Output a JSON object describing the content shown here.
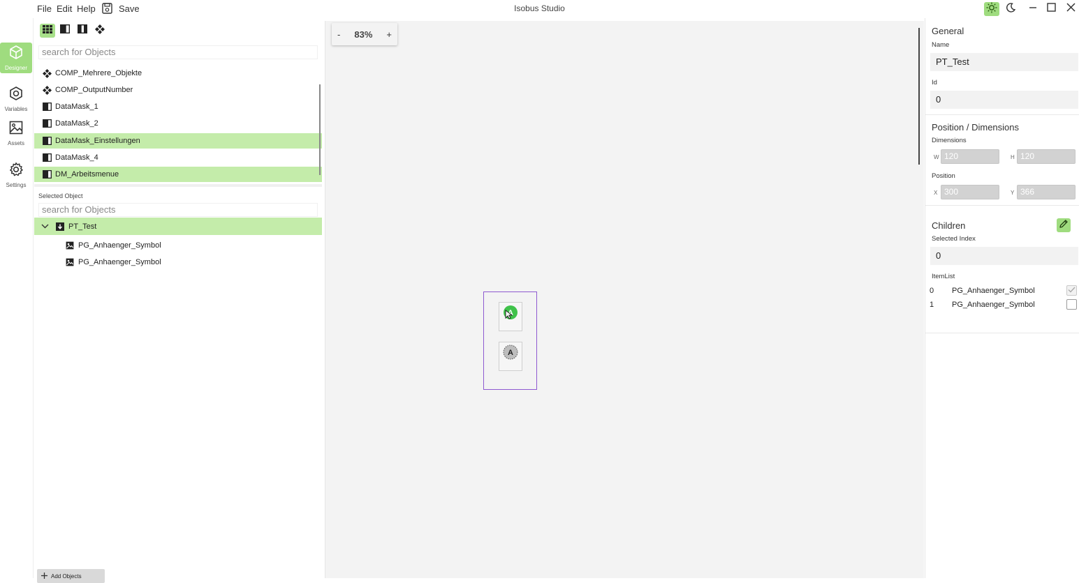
{
  "app": {
    "title": "Isobus Studio"
  },
  "menu": {
    "file": "File",
    "edit": "Edit",
    "help": "Help",
    "save": "Save"
  },
  "activity": {
    "designer": "Designer",
    "variables": "Variables",
    "assets": "Assets",
    "settings": "Settings"
  },
  "objects": {
    "search_placeholder": "search for Objects",
    "items": [
      {
        "label": "COMP_Mehrere_Objekte",
        "icon": "component-icon",
        "highlighted": false
      },
      {
        "label": "COMP_OutputNumber",
        "icon": "component-icon",
        "highlighted": false
      },
      {
        "label": "DataMask_1",
        "icon": "datamask-icon",
        "highlighted": false
      },
      {
        "label": "DataMask_2",
        "icon": "datamask-icon",
        "highlighted": false
      },
      {
        "label": "DataMask_Einstellungen",
        "icon": "datamask-icon",
        "highlighted": true
      },
      {
        "label": "DataMask_4",
        "icon": "datamask-icon",
        "highlighted": false
      },
      {
        "label": "DM_Arbeitsmenue",
        "icon": "datamask-icon",
        "highlighted": true
      }
    ]
  },
  "selected": {
    "label": "Selected Object",
    "search_placeholder": "search for Objects",
    "root": "PT_Test",
    "children": [
      "PG_Anhaenger_Symbol",
      "PG_Anhaenger_Symbol"
    ]
  },
  "add_button": "Add Objects",
  "canvas": {
    "zoom_minus": "-",
    "zoom_value": "83%",
    "zoom_plus": "+",
    "glyph_a": "A"
  },
  "properties": {
    "general_title": "General",
    "name_label": "Name",
    "name_value": "PT_Test",
    "id_label": "Id",
    "id_value": "0",
    "posdim_title": "Position / Dimensions",
    "dimensions_label": "Dimensions",
    "w_prefix": "W",
    "w_value": "120",
    "h_prefix": "H",
    "h_value": "120",
    "position_label": "Position",
    "x_prefix": "X",
    "x_value": "300",
    "y_prefix": "Y",
    "y_value": "366",
    "children_title": "Children",
    "selected_index_label": "Selected Index",
    "selected_index_value": "0",
    "itemlist_label": "ItemList",
    "items": [
      {
        "index": "0",
        "name": "PG_Anhaenger_Symbol",
        "checked": true
      },
      {
        "index": "1",
        "name": "PG_Anhaenger_Symbol",
        "checked": false
      }
    ]
  },
  "colors": {
    "accent": "#9fdc7f",
    "highlight": "#c4ecaa",
    "frame": "#8e59d0"
  }
}
